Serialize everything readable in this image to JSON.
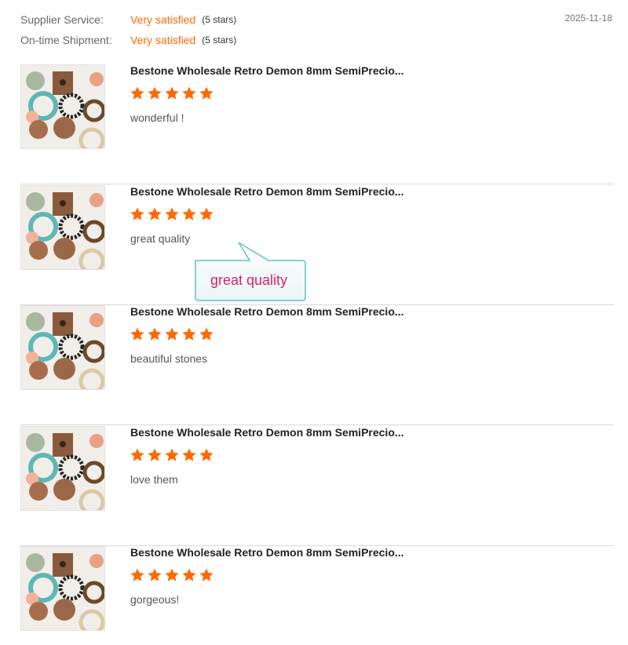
{
  "supplier_rating": {
    "label": "Supplier Service:",
    "value": "Very satisfied",
    "stars_note": "(5 stars)"
  },
  "shipment_rating": {
    "label": "On-time Shipment:",
    "value": "Very satisfied",
    "stars_note": "(5 stars)"
  },
  "review_date": "2025-11-18",
  "colors": {
    "accent_orange": "#ff6a00",
    "star": "#ff6a00",
    "callout_text": "#d6226e",
    "callout_border": "#5ec4c4"
  },
  "icons": {
    "star": "star-icon"
  },
  "reviews": [
    {
      "product": "Bestone Wholesale Retro Demon 8mm SemiPrecio...",
      "rating": 5,
      "comment": "wonderful !"
    },
    {
      "product": "Bestone Wholesale Retro Demon 8mm SemiPrecio...",
      "rating": 5,
      "comment": "great quality"
    },
    {
      "product": "Bestone Wholesale Retro Demon 8mm SemiPrecio...",
      "rating": 5,
      "comment": "beautiful stones"
    },
    {
      "product": "Bestone Wholesale Retro Demon 8mm SemiPrecio...",
      "rating": 5,
      "comment": "love them"
    },
    {
      "product": "Bestone Wholesale Retro Demon 8mm SemiPrecio...",
      "rating": 5,
      "comment": "gorgeous!"
    }
  ],
  "callout": {
    "text": "great quality"
  }
}
